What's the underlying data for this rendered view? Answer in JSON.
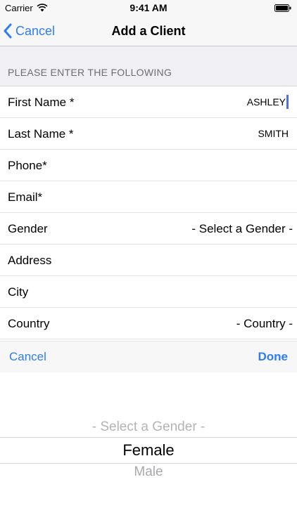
{
  "status_bar": {
    "carrier": "Carrier",
    "time": "9:41 AM",
    "icons": [
      "wifi-icon",
      "battery-icon"
    ]
  },
  "nav": {
    "back_label": "Cancel",
    "title": "Add a Client",
    "back_icon": "chevron-left-icon",
    "accent_color": "#2f7cf6"
  },
  "section": {
    "header": "PLEASE ENTER THE FOLLOWING"
  },
  "fields": [
    {
      "label": "First Name *",
      "value": "ASHLEY"
    },
    {
      "label": "Last Name *",
      "value": "SMITH"
    },
    {
      "label": "Phone*",
      "value": ""
    },
    {
      "label": "Email*",
      "value": ""
    },
    {
      "label": "Gender",
      "value": "- Select a Gender -"
    },
    {
      "label": "Address",
      "value": ""
    },
    {
      "label": "City",
      "value": ""
    },
    {
      "label": "Country",
      "value": "- Country -"
    }
  ],
  "picker_toolbar": {
    "cancel_label": "Cancel",
    "done_label": "Done"
  },
  "picker": {
    "options": [
      "- Select a Gender -",
      "Female",
      "Male"
    ],
    "selected": "Female"
  }
}
